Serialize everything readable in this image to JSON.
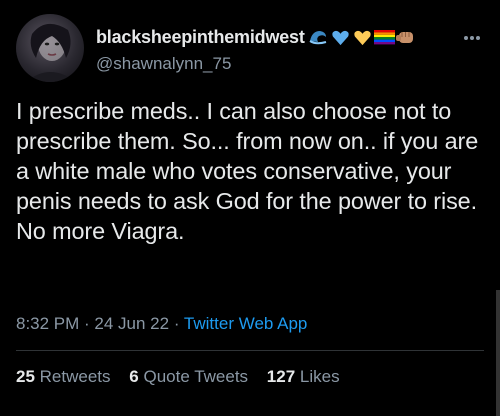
{
  "user": {
    "display_name": "blacksheepinthemidwest",
    "handle": "@shawnalynn_75",
    "name_emojis": [
      "wave-icon",
      "blue-heart-icon",
      "yellow-heart-icon",
      "rainbow-flag-icon",
      "fist-icon"
    ]
  },
  "tweet": {
    "text": "I prescribe meds.. I can also choose not to prescribe them. So... from now on.. if you are a white male who votes conservative, your penis needs to ask God for the power to rise. No more Viagra."
  },
  "meta": {
    "time": "8:32 PM",
    "sep1": " · ",
    "date": "24 Jun 22",
    "sep2": " · ",
    "source": "Twitter Web App"
  },
  "stats": {
    "retweets_count": "25",
    "retweets_label": "Retweets",
    "quotes_count": "6",
    "quotes_label": "Quote Tweets",
    "likes_count": "127",
    "likes_label": "Likes"
  },
  "colors": {
    "background": "#000000",
    "text": "#e7e9ea",
    "secondary": "#8b98a5",
    "link": "#1d9bf0",
    "divider": "#2f3336"
  }
}
